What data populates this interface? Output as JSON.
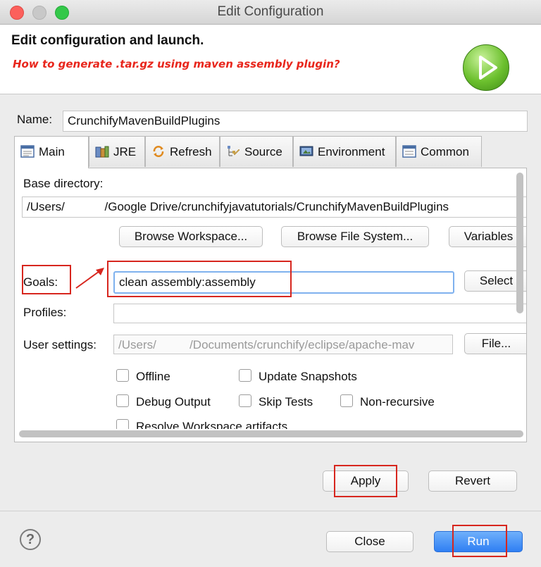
{
  "window": {
    "title": "Edit Configuration"
  },
  "header": {
    "title": "Edit configuration and launch.",
    "message": "How to generate .tar.gz using maven assembly plugin?"
  },
  "name_field": {
    "label": "Name:",
    "value": "CrunchifyMavenBuildPlugins"
  },
  "tabs": [
    {
      "label": "Main",
      "icon": "main-tab-icon"
    },
    {
      "label": "JRE",
      "icon": "jre-icon"
    },
    {
      "label": "Refresh",
      "icon": "refresh-icon"
    },
    {
      "label": "Source",
      "icon": "source-icon"
    },
    {
      "label": "Environment",
      "icon": "environment-icon"
    },
    {
      "label": "Common",
      "icon": "common-icon"
    }
  ],
  "main_tab": {
    "base_directory_label": "Base directory:",
    "base_directory_value": "/Users/            /Google Drive/crunchifyjavatutorials/CrunchifyMavenBuildPlugins",
    "browse_workspace": "Browse Workspace...",
    "browse_file_system": "Browse File System...",
    "variables": "Variables",
    "goals_label": "Goals:",
    "goals_value": "clean assembly:assembly",
    "select": "Select",
    "profiles_label": "Profiles:",
    "profiles_value": "",
    "user_settings_label": "User settings:",
    "user_settings_value": "/Users/          /Documents/crunchify/eclipse/apache-mav",
    "file": "File...",
    "checkboxes": {
      "offline": "Offline",
      "update_snapshots": "Update Snapshots",
      "debug_output": "Debug Output",
      "skip_tests": "Skip Tests",
      "non_recursive": "Non-recursive",
      "resolve_workspace": "Resolve Workspace artifacts"
    }
  },
  "actions": {
    "apply": "Apply",
    "revert": "Revert",
    "close": "Close",
    "run": "Run",
    "help": "?"
  },
  "colors": {
    "annotation_red": "#d7261e",
    "run_button_blue": "#3f8ff6",
    "header_message_red": "#e8261c"
  }
}
